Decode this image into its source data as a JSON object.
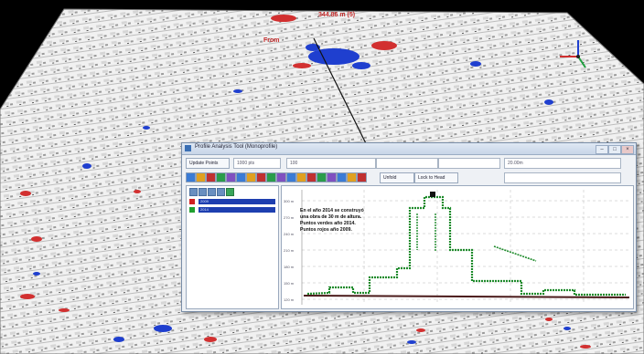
{
  "scene": {
    "label_from": "From",
    "label_distance": "344.86 m (5)"
  },
  "window": {
    "title": "Profile Analysis Tool (Monoprofile)",
    "buttons": {
      "minimize": "–",
      "maximize": "□",
      "close": "×"
    }
  },
  "toolbar_row1": {
    "view_button": "Update Points",
    "field1": "1000 pts",
    "field2": "100",
    "field3": "",
    "field4": "",
    "field5": "20.00m"
  },
  "toolbar_row2": {
    "tools": [
      "#3a7bd5",
      "#e0a020",
      "#c03030",
      "#2a9d4a",
      "#8050c0",
      "#3a7bd5",
      "#e0a020",
      "#c03030",
      "#2a9d4a",
      "#8050c0",
      "#3a7bd5",
      "#e0a020",
      "#c03030",
      "#2a9d4a",
      "#8050c0",
      "#3a7bd5",
      "#e0a020",
      "#c03030"
    ],
    "button_a": "Unfold",
    "button_b": "Lock to Head",
    "field_right": ""
  },
  "layers_panel": {
    "layers": [
      {
        "color": "#d02020",
        "label": "2009"
      },
      {
        "color": "#20a030",
        "label": "2014"
      }
    ]
  },
  "plot": {
    "y_ticks": [
      "300 m",
      "270 m",
      "240 m",
      "210 m",
      "180 m",
      "150 m",
      "120 m"
    ],
    "annotation": "En el año 2014 se construyó\nuna obra de 30 m de altura.\nPuntos verdes año 2014.\nPuntos rojos año 2009."
  }
}
